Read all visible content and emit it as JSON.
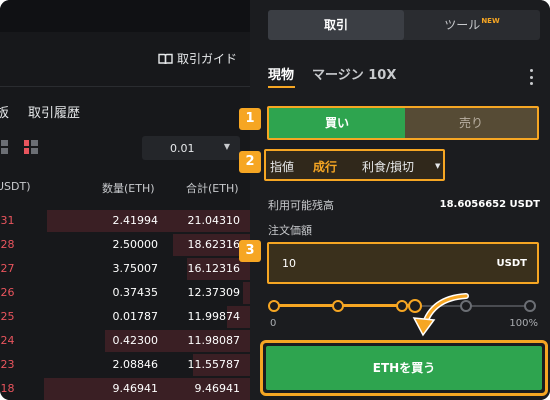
{
  "left": {
    "guide_label": "取引ガイド",
    "tabs": [
      {
        "label": "板"
      },
      {
        "label": "取引履歴"
      }
    ],
    "precision": "0.01",
    "columns": {
      "price": "USDT)",
      "amount": "数量(ETH)",
      "total": "合計(ETH)"
    },
    "rows": [
      {
        "price": ".31",
        "amount": "2.41994",
        "total": "21.04310",
        "depth": 0.9
      },
      {
        "price": ".28",
        "amount": "2.50000",
        "total": "18.62316",
        "depth": 0.34
      },
      {
        "price": ".27",
        "amount": "3.75007",
        "total": "16.12316",
        "depth": 0.28
      },
      {
        "price": ".26",
        "amount": "0.37435",
        "total": "12.37309",
        "depth": 0.03
      },
      {
        "price": ".25",
        "amount": "0.01787",
        "total": "11.99874",
        "depth": 0.1
      },
      {
        "price": ".24",
        "amount": "0.42300",
        "total": "11.98087",
        "depth": 0.64
      },
      {
        "price": ".23",
        "amount": "2.08846",
        "total": "11.55787",
        "depth": 0.25
      },
      {
        "price": ".18",
        "amount": "9.46941",
        "total": "9.46941",
        "depth": 0.91
      }
    ]
  },
  "right": {
    "segments": {
      "trade": "取引",
      "tools": "ツール",
      "new_badge": "NEW"
    },
    "mode_tabs": {
      "spot": "現物",
      "margin": "マージン 10X"
    },
    "side": {
      "buy": "買い",
      "sell": "売り"
    },
    "order_types": {
      "limit": "指値",
      "market": "成行",
      "tpsl": "利食/損切"
    },
    "available": {
      "label": "利用可能残高",
      "value": "18.6056652 USDT"
    },
    "amount": {
      "label": "注文価額",
      "value": "10",
      "unit": "USDT"
    },
    "slider": {
      "min_label": "0",
      "max_label": "100%",
      "percent": 55
    },
    "cta_label": "ETHを買う"
  },
  "badges": [
    "1",
    "2",
    "3"
  ],
  "colors": {
    "accent": "#f6a623",
    "buy": "#2ea44f",
    "sell_text": "#e8545d"
  }
}
